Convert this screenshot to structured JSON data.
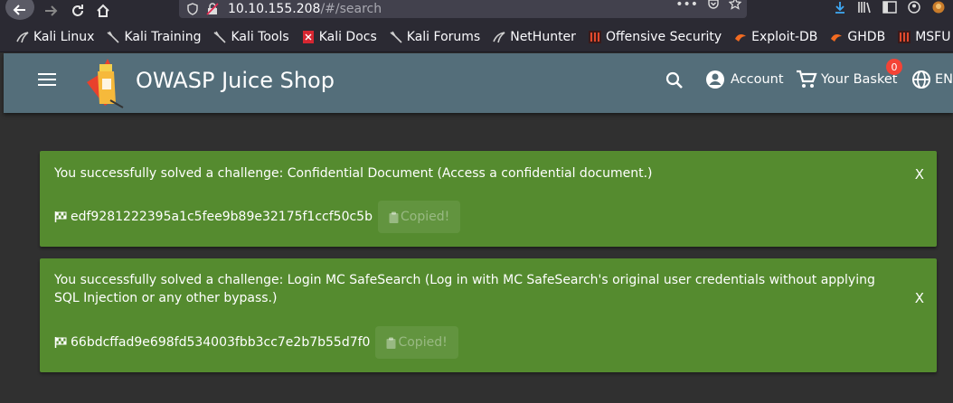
{
  "browser": {
    "url_host": "10.10.155.208",
    "url_path": "/#/search",
    "url_actions": "•••"
  },
  "bookmarks": [
    {
      "label": "Kali Linux",
      "icon": "kali-dragon-icon"
    },
    {
      "label": "Kali Training",
      "icon": "kali-dragon-icon"
    },
    {
      "label": "Kali Tools",
      "icon": "kali-dragon-icon"
    },
    {
      "label": "Kali Docs",
      "icon": "kali-docs-icon"
    },
    {
      "label": "Kali Forums",
      "icon": "kali-dragon-icon"
    },
    {
      "label": "NetHunter",
      "icon": "kali-dragon-icon"
    },
    {
      "label": "Offensive Security",
      "icon": "offsec-icon"
    },
    {
      "label": "Exploit-DB",
      "icon": "exploit-db-icon"
    },
    {
      "label": "GHDB",
      "icon": "exploit-db-icon"
    },
    {
      "label": "MSFU",
      "icon": "offsec-icon"
    }
  ],
  "header": {
    "title": "OWASP Juice Shop",
    "account_label": "Account",
    "basket_label": "Your Basket",
    "basket_count": "0",
    "language": "EN"
  },
  "notifications": [
    {
      "message": "You successfully solved a challenge: Confidential Document (Access a confidential document.)",
      "flag": "edf9281222395a1c5fee9b89e32175f1ccf50c5b",
      "copy_label": "Copied!",
      "close_label": "X"
    },
    {
      "message": "You successfully solved a challenge: Login MC SafeSearch (Log in with MC SafeSearch's original user credentials without applying SQL Injection or any other bypass.)",
      "flag": "66bdcffad9e698fd534003fbb3cc7e2b7b55d7f0",
      "copy_label": "Copied!",
      "close_label": "X"
    }
  ],
  "colors": {
    "header": "#546e7a",
    "notification": "#558b2f",
    "background": "#303030",
    "badge": "#f44336"
  }
}
